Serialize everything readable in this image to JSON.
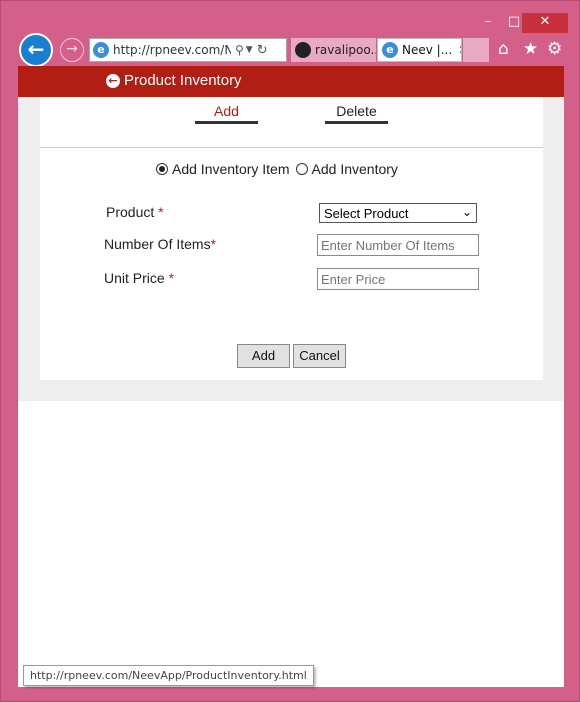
{
  "browser": {
    "window_controls": {
      "minimize": "–",
      "maximize": "□",
      "close": "✕"
    },
    "back_icon": "arrow-left-icon",
    "forward_icon": "arrow-right-icon",
    "address_url": "http://rpneev.com/Ne",
    "tabs": [
      {
        "label": "ravalipoo...",
        "icon": "github-icon"
      },
      {
        "label": "Neev |...",
        "icon": "ie-icon",
        "close": "✕"
      }
    ],
    "toolbar_icons": [
      "home-icon",
      "star-icon",
      "gear-icon"
    ],
    "status_url": "http://rpneev.com/NeevApp/ProductInventory.html"
  },
  "app": {
    "title": "Product Inventory",
    "tabs": {
      "add": "Add",
      "delete": "Delete"
    },
    "radio": {
      "option1": "Add Inventory Item",
      "option2": "Add Inventory",
      "selected": "option1"
    },
    "form": {
      "product_label": "Product",
      "items_label": "Number Of Items",
      "price_label": "Unit Price",
      "required_mark": "*",
      "product_select_value": "Select Product",
      "items_placeholder": "Enter Number Of Items",
      "price_placeholder": "Enter Price"
    },
    "buttons": {
      "add": "Add",
      "cancel": "Cancel"
    }
  },
  "colors": {
    "frame": "#d4608a",
    "header": "#b01e14",
    "required": "#c0201a"
  }
}
